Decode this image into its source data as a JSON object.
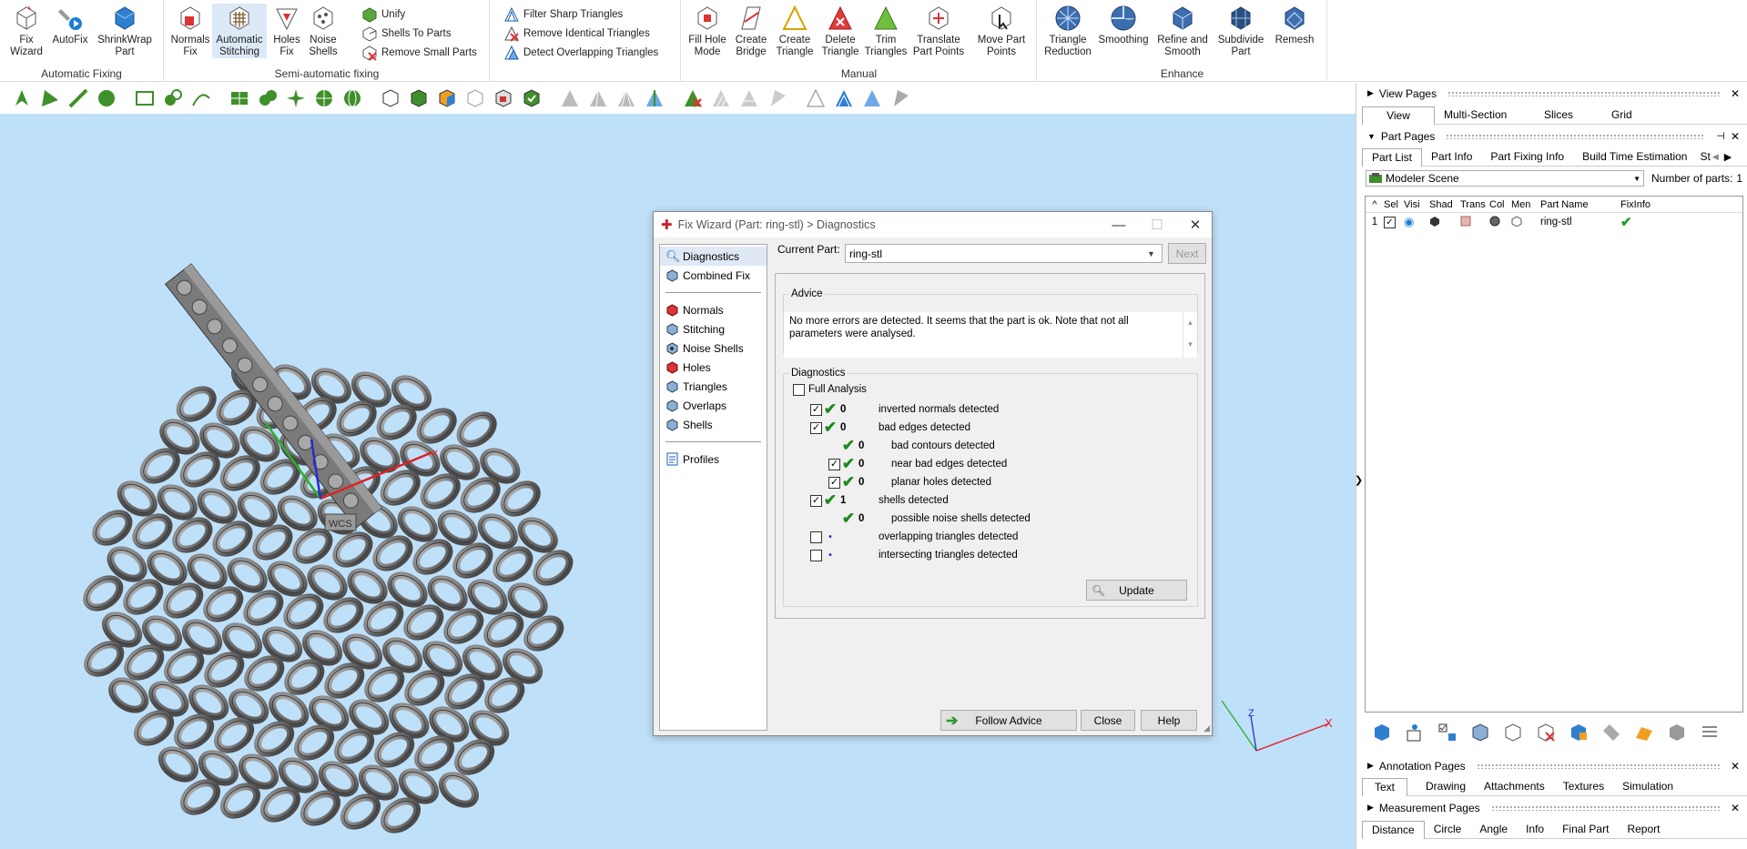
{
  "ribbon": {
    "groups": [
      {
        "label": "Automatic Fixing",
        "buttons": [
          {
            "label": "Fix\nWizard"
          },
          {
            "label": "AutoFix"
          },
          {
            "label": "ShrinkWrap\nPart"
          }
        ]
      },
      {
        "label": "Semi-automatic fixing",
        "buttons": [
          {
            "label": "Normals\nFix"
          },
          {
            "label": "Automatic\nStitching"
          },
          {
            "label": "Holes\nFix"
          },
          {
            "label": "Noise\nShells"
          }
        ],
        "small_buttons": [
          {
            "label": "Unify"
          },
          {
            "label": "Shells To Parts"
          },
          {
            "label": "Remove Small Parts"
          }
        ]
      },
      {
        "label": "",
        "small_buttons": [
          {
            "label": "Filter Sharp Triangles"
          },
          {
            "label": "Remove Identical Triangles"
          },
          {
            "label": "Detect Overlapping Triangles"
          }
        ]
      },
      {
        "label": "Manual",
        "buttons": [
          {
            "label": "Fill Hole\nMode"
          },
          {
            "label": "Create\nBridge"
          },
          {
            "label": "Create\nTriangle"
          },
          {
            "label": "Delete\nTriangle"
          },
          {
            "label": "Trim\nTriangles"
          },
          {
            "label": "Translate\nPart Points"
          },
          {
            "label": "Move Part\nPoints"
          }
        ]
      },
      {
        "label": "Enhance",
        "buttons": [
          {
            "label": "Triangle\nReduction"
          },
          {
            "label": "Smoothing"
          },
          {
            "label": "Refine and\nSmooth"
          },
          {
            "label": "Subdivide\nPart"
          },
          {
            "label": "Remesh"
          }
        ]
      }
    ]
  },
  "viewport": {
    "wcs_label": "WCS",
    "axes": {
      "x": "X",
      "z": "Z"
    }
  },
  "dialog": {
    "title": "Fix Wizard (Part: ring-stl) > Diagnostics",
    "nav": {
      "top": [
        "Diagnostics",
        "Combined Fix"
      ],
      "middle": [
        "Normals",
        "Stitching",
        "Noise Shells",
        "Holes",
        "Triangles",
        "Overlaps",
        "Shells"
      ],
      "bottom": [
        "Profiles"
      ]
    },
    "current_part_label": "Current Part:",
    "current_part_value": "ring-stl",
    "next_label": "Next",
    "advice_title": "Advice",
    "advice_text": "No more errors are detected. It seems that the part is ok. Note that not all parameters were analysed.",
    "diagnostics_title": "Diagnostics",
    "full_analysis_label": "Full Analysis",
    "rows": [
      {
        "checked": true,
        "status": "ok",
        "count": "0",
        "label": "inverted normals detected",
        "level": 0
      },
      {
        "checked": true,
        "status": "ok",
        "count": "0",
        "label": "bad edges detected",
        "level": 0
      },
      {
        "checked": null,
        "status": "ok",
        "count": "0",
        "label": "bad contours detected",
        "level": 1
      },
      {
        "checked": true,
        "status": "ok",
        "count": "0",
        "label": "near bad edges detected",
        "level": 1
      },
      {
        "checked": true,
        "status": "ok",
        "count": "0",
        "label": "planar holes detected",
        "level": 1
      },
      {
        "checked": true,
        "status": "ok",
        "count": "1",
        "label": "shells detected",
        "level": 0
      },
      {
        "checked": null,
        "status": "ok",
        "count": "0",
        "label": "possible noise shells detected",
        "level": 1
      },
      {
        "checked": false,
        "status": "dot",
        "count": "",
        "label": "overlapping triangles detected",
        "level": 0
      },
      {
        "checked": false,
        "status": "dot",
        "count": "",
        "label": "intersecting triangles detected",
        "level": 0
      }
    ],
    "update_label": "Update",
    "follow_advice_label": "Follow Advice",
    "close_label": "Close",
    "help_label": "Help"
  },
  "right_panel": {
    "view_pages": {
      "title": "View Pages",
      "tabs": [
        "View",
        "Multi-Section",
        "Slices",
        "Grid"
      ]
    },
    "part_pages": {
      "title": "Part Pages",
      "tabs": [
        "Part List",
        "Part Info",
        "Part Fixing Info",
        "Build Time Estimation",
        "St"
      ],
      "scene": "Modeler Scene",
      "num_parts_label": "Number of parts:",
      "num_parts_value": "1",
      "columns": [
        "^",
        "Sel",
        "Visi",
        "Shad",
        "Trans",
        "Col",
        "Men",
        "Part Name",
        "FixInfo"
      ],
      "rows": [
        {
          "index": "1",
          "name": "ring-stl"
        }
      ]
    },
    "annotation_pages": {
      "title": "Annotation Pages",
      "tabs": [
        "Text",
        "Drawing",
        "Attachments",
        "Textures",
        "Simulation"
      ]
    },
    "measurement_pages": {
      "title": "Measurement Pages",
      "tabs": [
        "Distance",
        "Circle",
        "Angle",
        "Info",
        "Final Part",
        "Report"
      ]
    }
  },
  "colors": {
    "viewport_bg": "#bfe0f9",
    "ok_green": "#1f8a1f",
    "ring_gray": "#8a8a8a"
  }
}
